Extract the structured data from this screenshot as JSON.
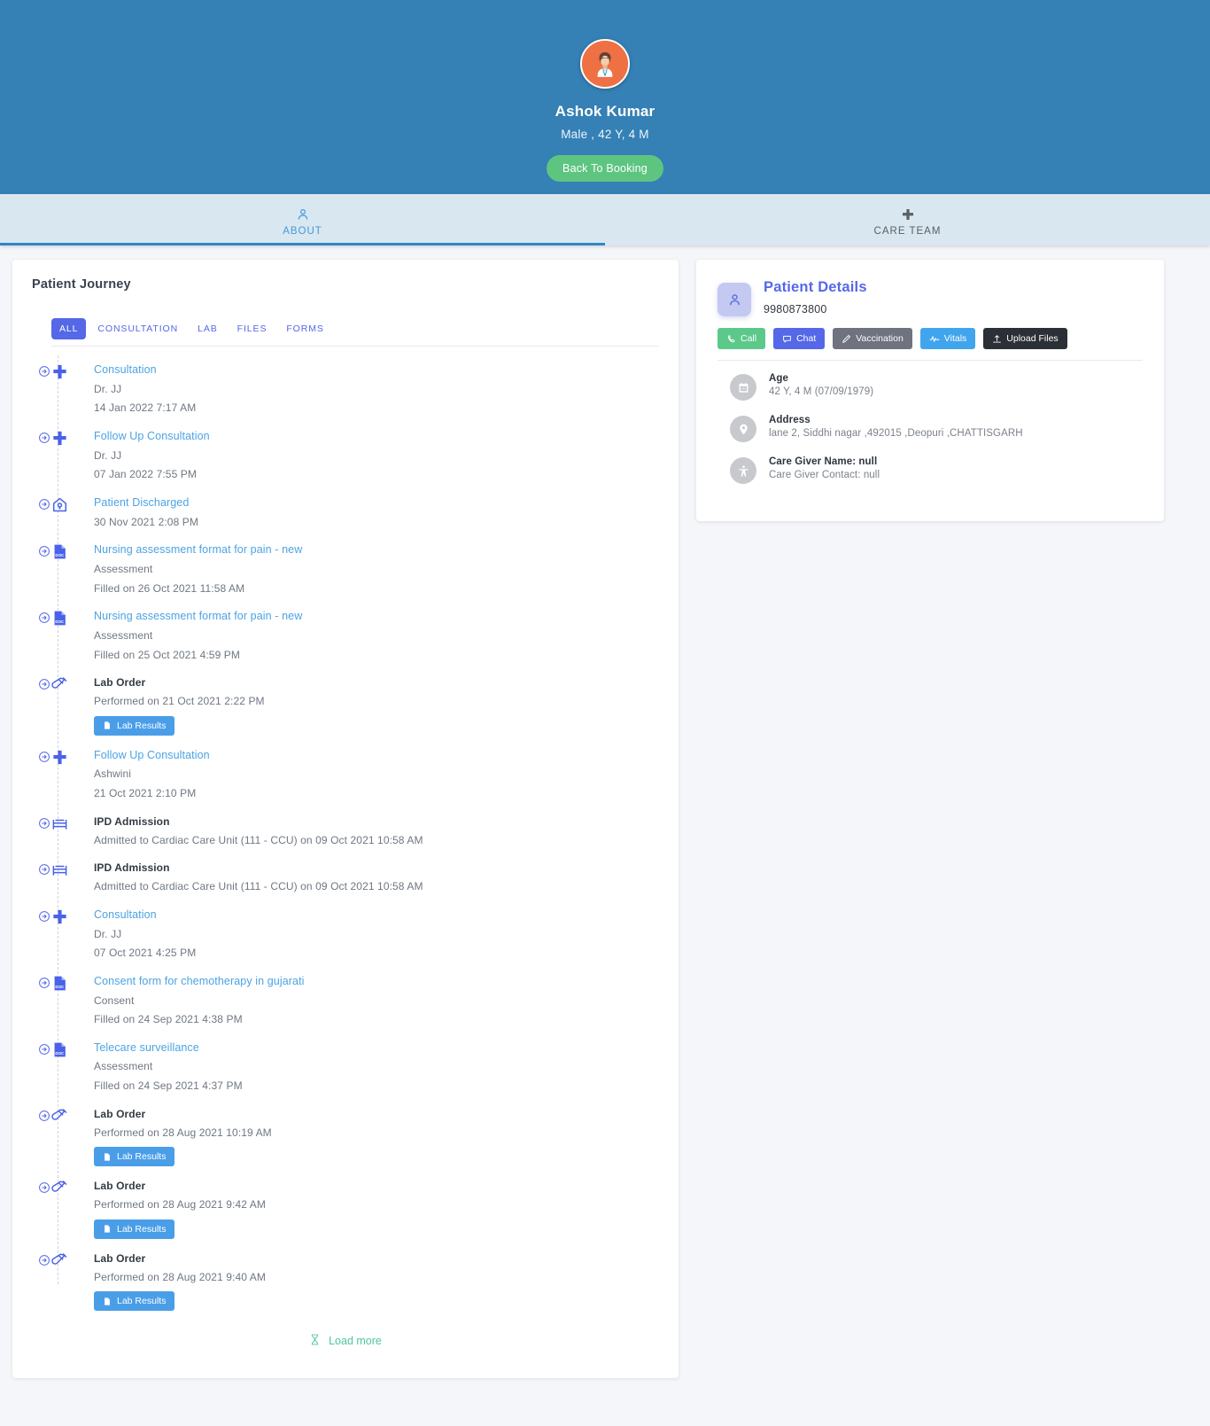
{
  "header": {
    "avatar_icon": "patient-avatar-icon",
    "name": "Ashok Kumar",
    "meta": "Male , 42 Y, 4 M",
    "back_button": "Back To Booking",
    "bg_color": "#3580b5",
    "button_color": "#5dc57f"
  },
  "tabs": [
    {
      "label": "ABOUT",
      "icon": "person-icon",
      "active": true
    },
    {
      "label": "CARE TEAM",
      "icon": "plus-icon",
      "active": false
    }
  ],
  "journey": {
    "title": "Patient Journey",
    "filters": [
      {
        "label": "ALL",
        "active": true
      },
      {
        "label": "CONSULTATION",
        "active": false
      },
      {
        "label": "LAB",
        "active": false
      },
      {
        "label": "FILES",
        "active": false
      },
      {
        "label": "FORMS",
        "active": false
      }
    ],
    "accent_color": "#5468e8",
    "items": [
      {
        "icon": "plus-icon",
        "title": "Consultation",
        "title_style": "link",
        "lines": [
          "Dr. JJ",
          "14 Jan 2022 7:17 AM"
        ],
        "button": null
      },
      {
        "icon": "plus-icon",
        "title": "Follow Up Consultation",
        "title_style": "link",
        "lines": [
          "Dr. JJ",
          "07 Jan 2022 7:55 PM"
        ],
        "button": null
      },
      {
        "icon": "home-icon",
        "title": "Patient Discharged",
        "title_style": "link",
        "lines": [
          "30 Nov 2021 2:08 PM"
        ],
        "button": null
      },
      {
        "icon": "doc-icon",
        "title": "Nursing assessment format for pain - new",
        "title_style": "link",
        "lines": [
          "Assessment",
          "Filled on 26 Oct 2021 11:58 AM"
        ],
        "button": null
      },
      {
        "icon": "doc-icon",
        "title": "Nursing assessment format for pain - new",
        "title_style": "link",
        "lines": [
          "Assessment",
          "Filled on 25 Oct 2021 4:59 PM"
        ],
        "button": null
      },
      {
        "icon": "test-tube-icon",
        "title": "Lab Order",
        "title_style": "plain",
        "lines": [
          "Performed on 21 Oct 2021 2:22 PM"
        ],
        "button": "Lab Results"
      },
      {
        "icon": "plus-icon",
        "title": "Follow Up Consultation",
        "title_style": "link",
        "lines": [
          "Ashwini",
          "21 Oct 2021 2:10 PM"
        ],
        "button": null
      },
      {
        "icon": "bed-icon",
        "title": "IPD Admission",
        "title_style": "plain",
        "lines": [
          "Admitted to Cardiac Care Unit (111 - CCU) on 09 Oct 2021 10:58 AM"
        ],
        "button": null
      },
      {
        "icon": "bed-icon",
        "title": "IPD Admission",
        "title_style": "plain",
        "lines": [
          "Admitted to Cardiac Care Unit (111 - CCU) on 09 Oct 2021 10:58 AM"
        ],
        "button": null
      },
      {
        "icon": "plus-icon",
        "title": "Consultation",
        "title_style": "link",
        "lines": [
          "Dr. JJ",
          "07 Oct 2021 4:25 PM"
        ],
        "button": null
      },
      {
        "icon": "doc-icon",
        "title": "Consent form for chemotherapy in gujarati",
        "title_style": "link",
        "lines": [
          "Consent",
          "Filled on 24 Sep 2021 4:38 PM"
        ],
        "button": null
      },
      {
        "icon": "doc-icon",
        "title": "Telecare surveillance",
        "title_style": "link",
        "lines": [
          "Assessment",
          "Filled on 24 Sep 2021 4:37 PM"
        ],
        "button": null
      },
      {
        "icon": "test-tube-icon",
        "title": "Lab Order",
        "title_style": "plain",
        "lines": [
          "Performed on 28 Aug 2021 10:19 AM"
        ],
        "button": "Lab Results"
      },
      {
        "icon": "test-tube-icon",
        "title": "Lab Order",
        "title_style": "plain",
        "lines": [
          "Performed on 28 Aug 2021 9:42 AM"
        ],
        "button": "Lab Results"
      },
      {
        "icon": "test-tube-icon",
        "title": "Lab Order",
        "title_style": "plain",
        "lines": [
          "Performed on 28 Aug 2021 9:40 AM"
        ],
        "button": "Lab Results"
      }
    ],
    "load_more": {
      "label": "Load more",
      "icon": "hourglass-icon",
      "color": "#4ec6a0"
    }
  },
  "patient_details": {
    "title": "Patient Details",
    "avatar_icon": "person-icon",
    "phone": "9980873800",
    "actions": [
      {
        "label": "Call",
        "icon": "phone-icon",
        "color": "#5cc98b"
      },
      {
        "label": "Chat",
        "icon": "chat-icon",
        "color": "#5468e8"
      },
      {
        "label": "Vaccination",
        "icon": "syringe-icon",
        "color": "#6e737f"
      },
      {
        "label": "Vitals",
        "icon": "pulse-icon",
        "color": "#41a5ed"
      },
      {
        "label": "Upload Files",
        "icon": "upload-icon",
        "color": "#2b2f36"
      }
    ],
    "rows": [
      {
        "icon": "calendar-icon",
        "label": "Age",
        "value": "42 Y, 4 M (07/09/1979)"
      },
      {
        "icon": "location-pin-icon",
        "label": "Address",
        "value": "lane 2, Siddhi nagar ,492015 ,Deopuri ,CHATTISGARH"
      },
      {
        "icon": "accessibility-icon",
        "label": "Care Giver Name: null",
        "value": "Care Giver Contact: null"
      }
    ]
  }
}
